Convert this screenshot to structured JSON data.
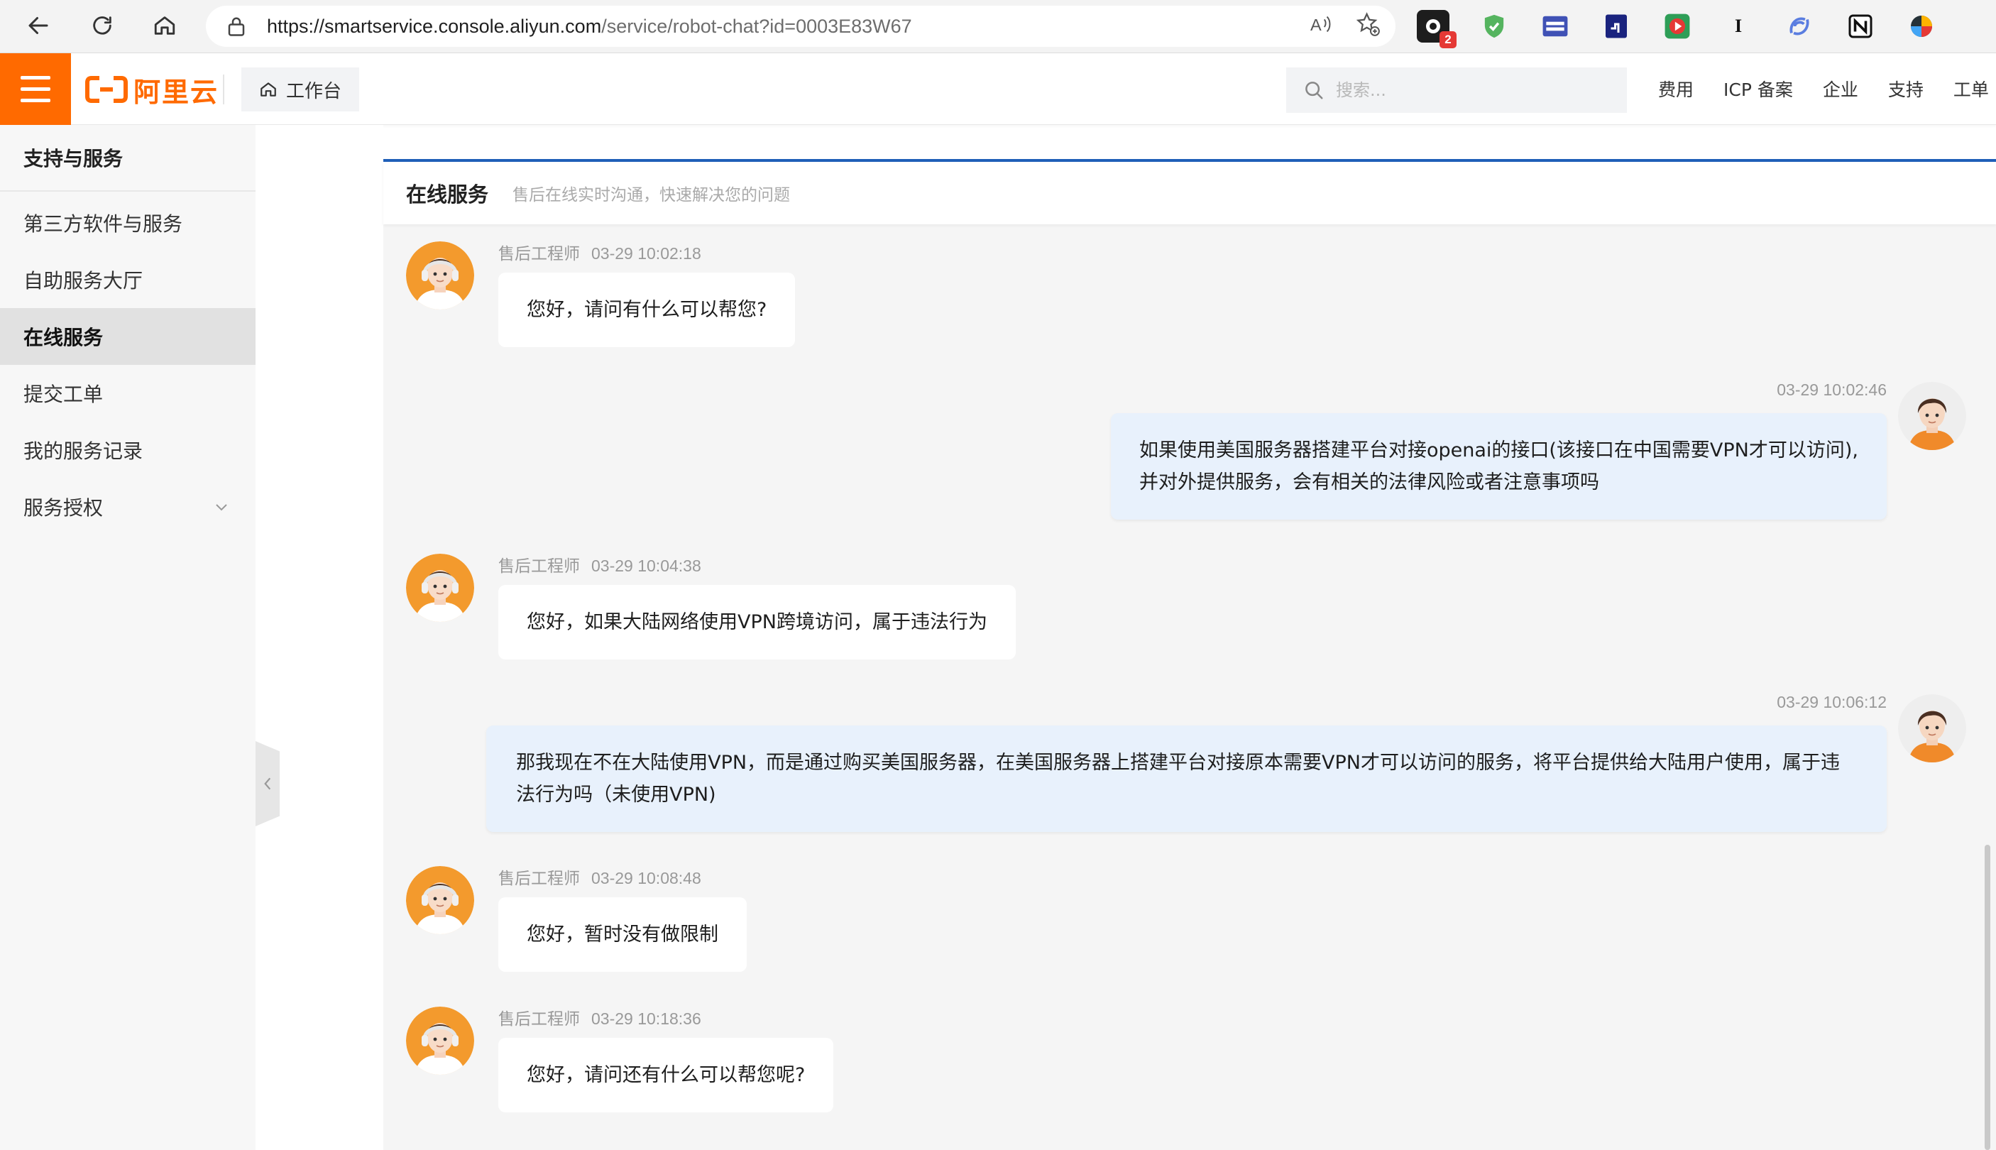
{
  "browser": {
    "url_host": "https://smartservice.console.aliyun.com",
    "url_path": "/service/robot-chat?id=0003E83W67",
    "extension_badge": "2",
    "extensions": [
      "extension-dark",
      "extension-shield",
      "extension-window",
      "extension-blue",
      "extension-play",
      "extension-i",
      "extension-swirl",
      "extension-notion",
      "extension-color"
    ]
  },
  "header": {
    "logo_text": "阿里云",
    "workbench_label": "工作台",
    "search_placeholder": "搜索...",
    "nav": [
      "费用",
      "ICP 备案",
      "企业",
      "支持",
      "工单"
    ]
  },
  "sidebar": {
    "title": "支持与服务",
    "items": [
      {
        "label": "第三方软件与服务",
        "active": false
      },
      {
        "label": "自助服务大厅",
        "active": false
      },
      {
        "label": "在线服务",
        "active": true
      },
      {
        "label": "提交工单",
        "active": false
      },
      {
        "label": "我的服务记录",
        "active": false
      },
      {
        "label": "服务授权",
        "active": false
      }
    ]
  },
  "panel": {
    "title": "在线服务",
    "subtitle": "售后在线实时沟通，快速解决您的问题"
  },
  "messages": [
    {
      "role": "agent",
      "sender": "售后工程师",
      "time": "03-29 10:02:18",
      "lines": [
        "您好，请问有什么可以帮您?"
      ]
    },
    {
      "role": "user",
      "time": "03-29 10:02:46",
      "lines": [
        "如果使用美国服务器搭建平台对接openai的接口(该接口在中国需要VPN才可以访问),",
        "并对外提供服务，会有相关的法律风险或者注意事项吗"
      ]
    },
    {
      "role": "agent",
      "sender": "售后工程师",
      "time": "03-29 10:04:38",
      "lines": [
        "您好，如果大陆网络使用VPN跨境访问，属于违法行为"
      ]
    },
    {
      "role": "user",
      "time": "03-29 10:06:12",
      "lines": [
        "那我现在不在大陆使用VPN，而是通过购买美国服务器，在美国服务器上搭建平台对接原本需要VPN才可以访问的服务，将平台提供给大陆用户使用，属于违",
        "法行为吗（未使用VPN)"
      ]
    },
    {
      "role": "agent",
      "sender": "售后工程师",
      "time": "03-29 10:08:48",
      "lines": [
        "您好，暂时没有做限制"
      ]
    },
    {
      "role": "agent",
      "sender": "售后工程师",
      "time": "03-29 10:18:36",
      "lines": [
        "您好，请问还有什么可以帮您呢?"
      ]
    }
  ],
  "colors": {
    "brand_orange": "#ff6a00",
    "panel_accent": "#1f5fb8",
    "user_bubble": "#e8f1fc"
  }
}
